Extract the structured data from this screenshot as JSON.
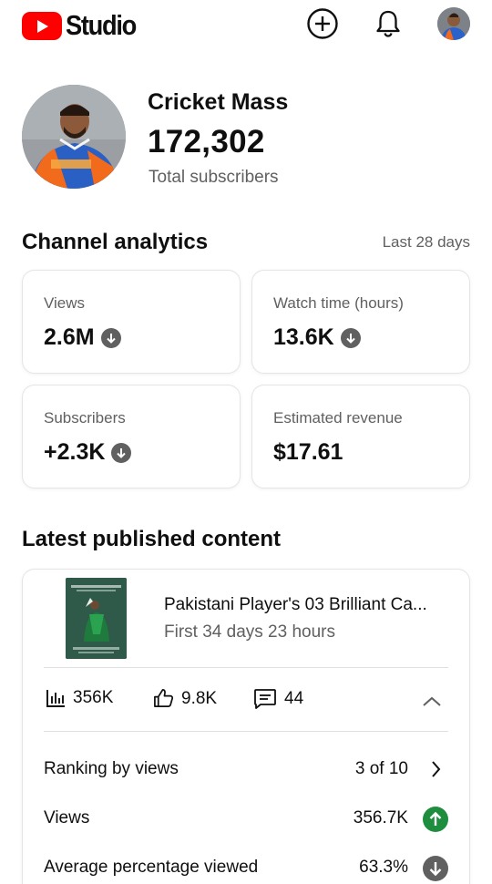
{
  "header": {
    "logo_text": "Studio",
    "icons": [
      "create-icon",
      "notifications-icon",
      "account-avatar"
    ],
    "brand_color": "#ff0000"
  },
  "channel": {
    "name": "Cricket Mass",
    "subscriber_count": "172,302",
    "subscriber_label": "Total subscribers"
  },
  "analytics": {
    "title": "Channel analytics",
    "period": "Last 28 days",
    "cards": [
      {
        "label": "Views",
        "value": "2.6M",
        "trend": "down"
      },
      {
        "label": "Watch time (hours)",
        "value": "13.6K",
        "trend": "down"
      },
      {
        "label": "Subscribers",
        "value": "+2.3K",
        "trend": "down"
      },
      {
        "label": "Estimated revenue",
        "value": "$17.61",
        "trend": "none"
      }
    ]
  },
  "latest": {
    "title": "Latest published content",
    "video": {
      "title": "Pakistani Player's 03 Brilliant Ca...",
      "age": "First 34 days 23 hours",
      "views": "356K",
      "likes": "9.8K",
      "comments": "44"
    },
    "metrics": [
      {
        "label": "Ranking by views",
        "value": "3 of 10",
        "end": "chevron-right"
      },
      {
        "label": "Views",
        "value": "356.7K",
        "end": "up"
      },
      {
        "label": "Average percentage viewed",
        "value": "63.3%",
        "end": "down"
      }
    ],
    "colors": {
      "up": "#1e8e3e",
      "down": "#606060"
    }
  }
}
